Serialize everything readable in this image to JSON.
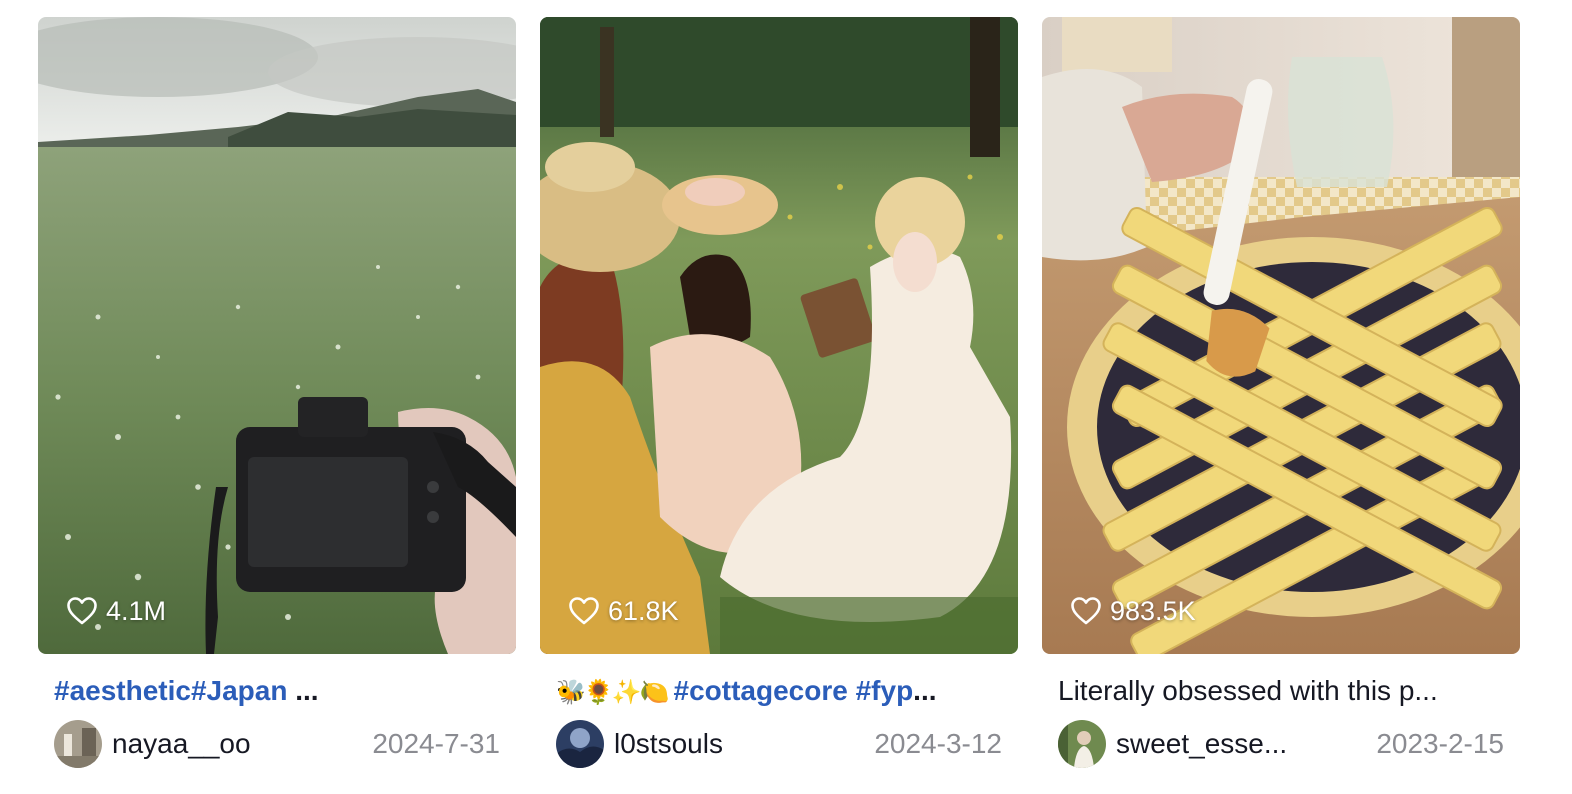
{
  "videos": [
    {
      "likes": "4.1M",
      "caption_tags": "#aesthetic#Japan",
      "caption_ellipsis": " ...",
      "username": "nayaa__oo",
      "date": "2024-7-31"
    },
    {
      "likes": "61.8K",
      "caption_emoji": "🐝🌻✨🍋",
      "caption_tags": "#cottagecore #fyp",
      "caption_ellipsis": "...",
      "username": "l0stsouls",
      "date": "2024-3-12"
    },
    {
      "likes": "983.5K",
      "caption_text": "Literally obsessed with this p...",
      "username": "sweet_esse...",
      "date": "2023-2-15"
    }
  ],
  "colors": {
    "hashtag": "#2b5db9",
    "text": "#161823",
    "date": "#8a8b91",
    "overlay_text": "#ffffff"
  },
  "icons": {
    "likes": "heart-outline-icon"
  }
}
